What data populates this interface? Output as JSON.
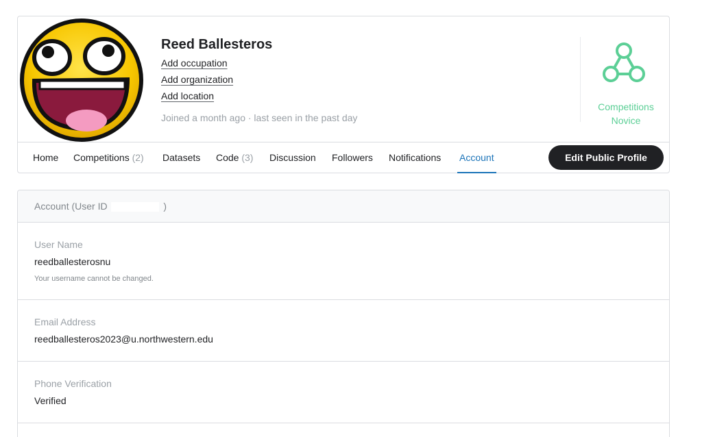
{
  "profile": {
    "name": "Reed Ballesteros",
    "add_occupation": "Add occupation",
    "add_organization": "Add organization",
    "add_location": "Add location",
    "joined": "Joined a month ago · last seen in the past day",
    "avatar_icon": "awesome-smiley-avatar",
    "tier": {
      "line1": "Competitions",
      "line2": "Novice",
      "color": "#5ccf96",
      "icon": "novice-tier-icon"
    }
  },
  "tabs": [
    {
      "label": "Home"
    },
    {
      "label": "Competitions",
      "count": "(2)"
    },
    {
      "label": "Datasets"
    },
    {
      "label": "Code",
      "count": "(3)"
    },
    {
      "label": "Discussion"
    },
    {
      "label": "Followers"
    },
    {
      "label": "Notifications"
    },
    {
      "label": "Account",
      "active": true
    }
  ],
  "edit_button": "Edit Public Profile",
  "account": {
    "header_prefix": "Account (User ID",
    "header_suffix": ")",
    "username_label": "User Name",
    "username_value": "reedballesterosnu",
    "username_hint": "Your username cannot be changed.",
    "email_label": "Email Address",
    "email_value": "reedballesteros2023@u.northwestern.edu",
    "phone_label": "Phone Verification",
    "phone_value": "Verified"
  },
  "colors": {
    "accent": "#1a73b8",
    "tier": "#5ccf96",
    "button": "#202124"
  }
}
